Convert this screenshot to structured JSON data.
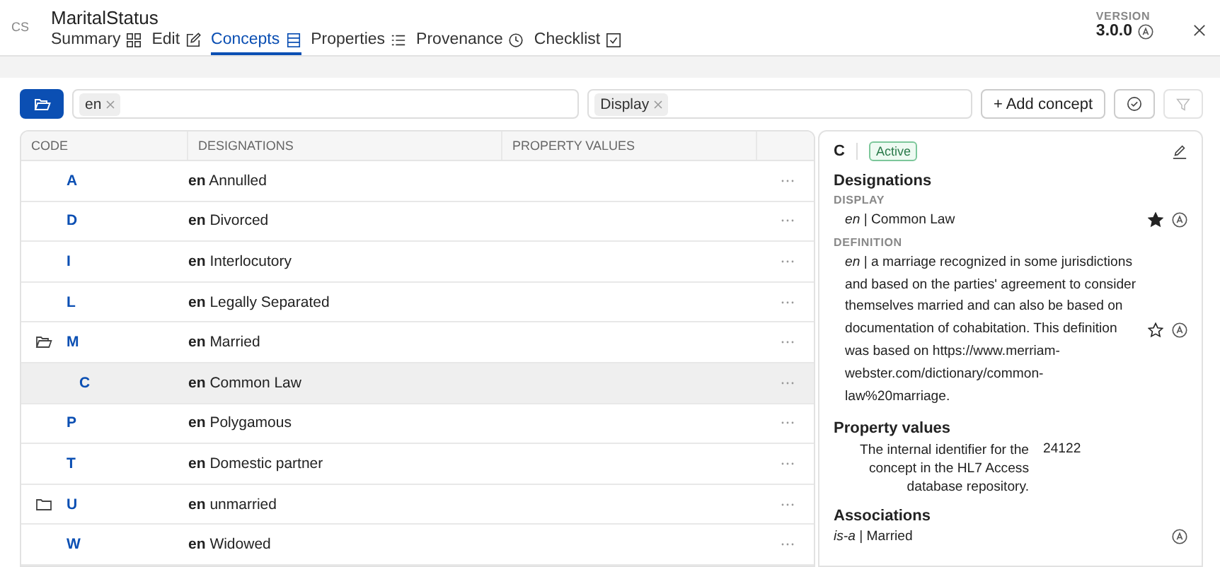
{
  "header": {
    "prefix": "CS",
    "title": "MaritalStatus",
    "version_label": "VERSION",
    "version": "3.0.0"
  },
  "tabs": [
    {
      "label": "Summary",
      "selected": false
    },
    {
      "label": "Edit",
      "selected": false
    },
    {
      "label": "Concepts",
      "selected": true
    },
    {
      "label": "Properties",
      "selected": false
    },
    {
      "label": "Provenance",
      "selected": false
    },
    {
      "label": "Checklist",
      "selected": false
    }
  ],
  "filters": {
    "language_chips": [
      "en"
    ],
    "property_chips": [
      "Display"
    ],
    "add_button": "+ Add concept"
  },
  "table": {
    "columns": [
      "CODE",
      "DESIGNATIONS",
      "PROPERTY VALUES"
    ],
    "rows": [
      {
        "code": "A",
        "lang": "en",
        "designation": "Annulled",
        "selected": false
      },
      {
        "code": "D",
        "lang": "en",
        "designation": "Divorced",
        "selected": false
      },
      {
        "code": "I",
        "lang": "en",
        "designation": "Interlocutory",
        "selected": false
      },
      {
        "code": "L",
        "lang": "en",
        "designation": "Legally Separated",
        "selected": false
      },
      {
        "code": "M",
        "lang": "en",
        "designation": "Married",
        "selected": false,
        "expanded": true,
        "children": [
          {
            "code": "C",
            "lang": "en",
            "designation": "Common Law",
            "selected": true
          }
        ]
      },
      {
        "code": "P",
        "lang": "en",
        "designation": "Polygamous",
        "selected": false
      },
      {
        "code": "T",
        "lang": "en",
        "designation": "Domestic partner",
        "selected": false
      },
      {
        "code": "U",
        "lang": "en",
        "designation": "unmarried",
        "selected": false,
        "expanded": false
      },
      {
        "code": "W",
        "lang": "en",
        "designation": "Widowed",
        "selected": false
      }
    ]
  },
  "detail": {
    "code": "C",
    "status": "Active",
    "designations_title": "Designations",
    "designations": [
      {
        "type": "DISPLAY",
        "text": "*en* | Common Law",
        "preferred": true
      },
      {
        "type": "DEFINITION",
        "text": "*en* | a marriage recognized in some jurisdictions and based on the parties' agreement to consider themselves married and can also be based on documentation of cohabitation. This definition was based on https://www.merriam-webster.com/dictionary/common-law%20marriage.",
        "preferred": false
      }
    ],
    "properties_title": "Property values",
    "properties": [
      {
        "name": "The internal identifier for the concept in the HL7 Access database repository.",
        "value": "24122"
      }
    ],
    "associations_title": "Associations",
    "associations": [
      {
        "text": "*is-a* | Married"
      }
    ]
  }
}
